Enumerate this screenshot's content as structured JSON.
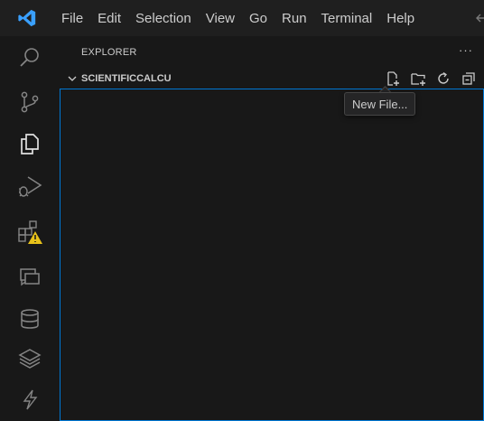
{
  "menu": [
    "File",
    "Edit",
    "Selection",
    "View",
    "Go",
    "Run",
    "Terminal",
    "Help"
  ],
  "explorer": {
    "title": "EXPLORER",
    "more_actions": "···",
    "folder_name": "SCIENTIFICCALCU"
  },
  "tooltip": "New File...",
  "colors": {
    "accent": "#0078d4",
    "logo": "#3aa0ff",
    "warning": "#e8c21a"
  },
  "icons": {
    "activity_bar": [
      "search-icon",
      "source-control-icon",
      "explorer-icon",
      "run-debug-icon",
      "extensions-icon",
      "remote-explorer-icon",
      "database-icon",
      "layers-icon",
      "lightning-icon"
    ],
    "section_actions": [
      "new-file-icon",
      "new-folder-icon",
      "refresh-icon",
      "collapse-all-icon"
    ]
  }
}
